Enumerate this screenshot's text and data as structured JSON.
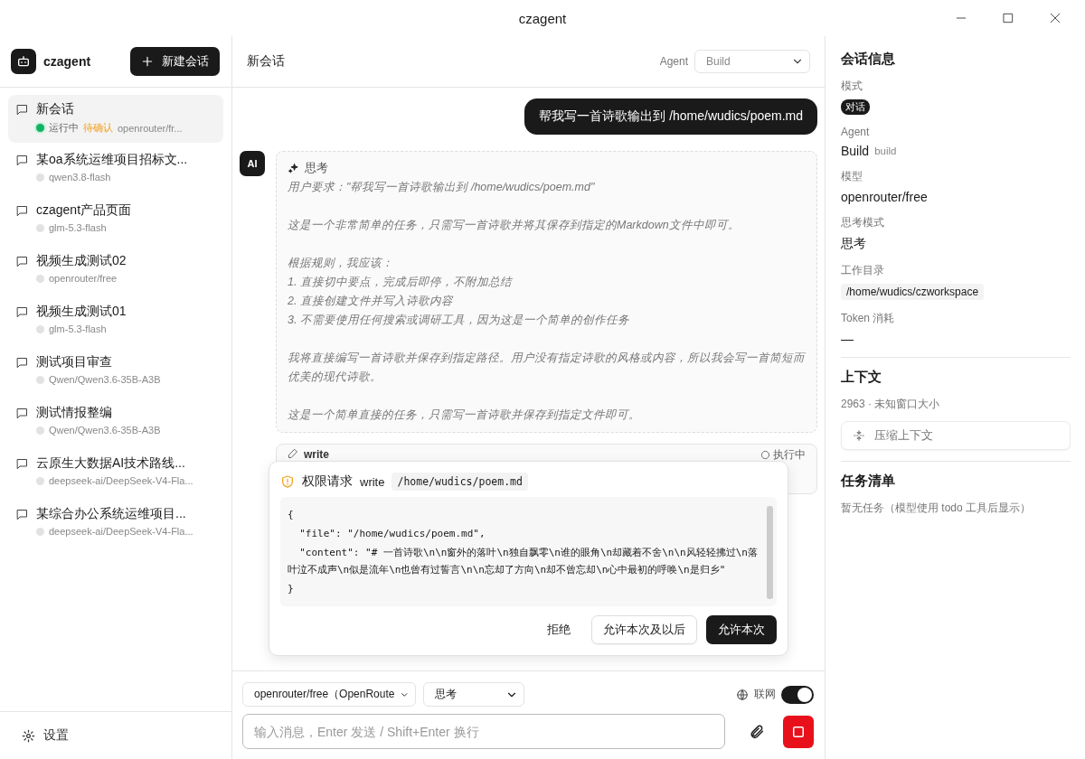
{
  "window": {
    "title": "czagent"
  },
  "sidebar": {
    "app_name": "czagent",
    "new_button": "新建会话",
    "settings": "设置",
    "sessions": [
      {
        "title": "新会话",
        "selected": true,
        "running": true,
        "status": "运行中",
        "pending": "待确认",
        "model": "openrouter/fr..."
      },
      {
        "title": "某oa系统运维项目招标文...",
        "selected": false,
        "running": false,
        "model": "qwen3.8-flash"
      },
      {
        "title": "czagent产品页面",
        "selected": false,
        "running": false,
        "model": "glm-5.3-flash"
      },
      {
        "title": "视频生成测试02",
        "selected": false,
        "running": false,
        "model": "openrouter/free"
      },
      {
        "title": "视频生成测试01",
        "selected": false,
        "running": false,
        "model": "glm-5.3-flash"
      },
      {
        "title": "测试项目审查",
        "selected": false,
        "running": false,
        "model": "Qwen/Qwen3.6-35B-A3B"
      },
      {
        "title": "测试情报整编",
        "selected": false,
        "running": false,
        "model": "Qwen/Qwen3.6-35B-A3B"
      },
      {
        "title": "云原生大数据AI技术路线...",
        "selected": false,
        "running": false,
        "model": "deepseek-ai/DeepSeek-V4-Fla..."
      },
      {
        "title": "某综合办公系统运维项目...",
        "selected": false,
        "running": false,
        "model": "deepseek-ai/DeepSeek-V4-Fla..."
      }
    ]
  },
  "chat": {
    "title": "新会话",
    "agent_label": "Agent",
    "agent_value": "Build",
    "messages": [
      {
        "kind": "user",
        "text": "帮我写一首诗歌输出到 /home/wudics/poem.md"
      },
      {
        "kind": "thinking",
        "avatar": "AI",
        "label": "思考",
        "paragraphs": [
          [
            "用户要求：\"帮我写一首诗歌输出到 /home/wudics/poem.md\""
          ],
          [
            "这是一个非常简单的任务，只需写一首诗歌并将其保存到指定的Markdown文件中即可。"
          ],
          [
            "根据规则，我应该：",
            "1. 直接切中要点，完成后即停，不附加总结",
            "2. 直接创建文件并写入诗歌内容",
            "3. 不需要使用任何搜索或调研工具，因为这是一个简单的创作任务"
          ],
          [
            "我将直接编写一首诗歌并保存到指定路径。用户没有指定诗歌的风格或内容，所以我会写一首简短而优美的现代诗歌。"
          ],
          [
            "这是一个简单直接的任务，只需写一首诗歌并保存到指定文件即可。"
          ]
        ]
      },
      {
        "kind": "tool",
        "name": "write",
        "status": "执行中"
      }
    ]
  },
  "permission": {
    "title": "权限请求",
    "tool": "write",
    "path": "/home/wudics/poem.md",
    "code_lines": [
      "{",
      "  \"file\": \"/home/wudics/poem.md\",",
      "  \"content\": \"# 一首诗歌\\n\\n窗外的落叶\\n独自飘零\\n谁的眼角\\n却藏着不舍\\n\\n风轻轻拂过\\n落叶泣不成声\\n似是流年\\n也曾有过誓言\\n\\n忘却了方向\\n却不曾忘却\\n心中最初的呼唤\\n是归乡\"",
      "}"
    ],
    "buttons": [
      {
        "label": "拒绝",
        "kind": "text"
      },
      {
        "label": "允许本次及以后",
        "kind": "outline"
      },
      {
        "label": "允许本次",
        "kind": "primary"
      }
    ]
  },
  "composer": {
    "model": "openrouter/free（OpenRoute",
    "thinking": "思考",
    "web_label": "联网",
    "web_on": true,
    "placeholder": "输入消息，Enter 发送 / Shift+Enter 换行"
  },
  "info": {
    "title": "会话信息",
    "fields": [
      {
        "kind": "badge",
        "label": "模式",
        "value": "对话"
      },
      {
        "kind": "agent",
        "label": "Agent",
        "value": "Build",
        "sub": "build"
      },
      {
        "kind": "text",
        "label": "模型",
        "value": "openrouter/free"
      },
      {
        "kind": "text",
        "label": "思考模式",
        "value": "思考"
      },
      {
        "kind": "path",
        "label": "工作目录",
        "value": "/home/wudics/czworkspace"
      },
      {
        "kind": "text",
        "label": "Token 消耗",
        "value": "—"
      }
    ],
    "context_title": "上下文",
    "context_text": "2963 · 未知窗口大小",
    "compress_button": "压缩上下文",
    "tasks_title": "任务清单",
    "tasks_text": "暂无任务（模型使用 todo 工具后显示）"
  }
}
